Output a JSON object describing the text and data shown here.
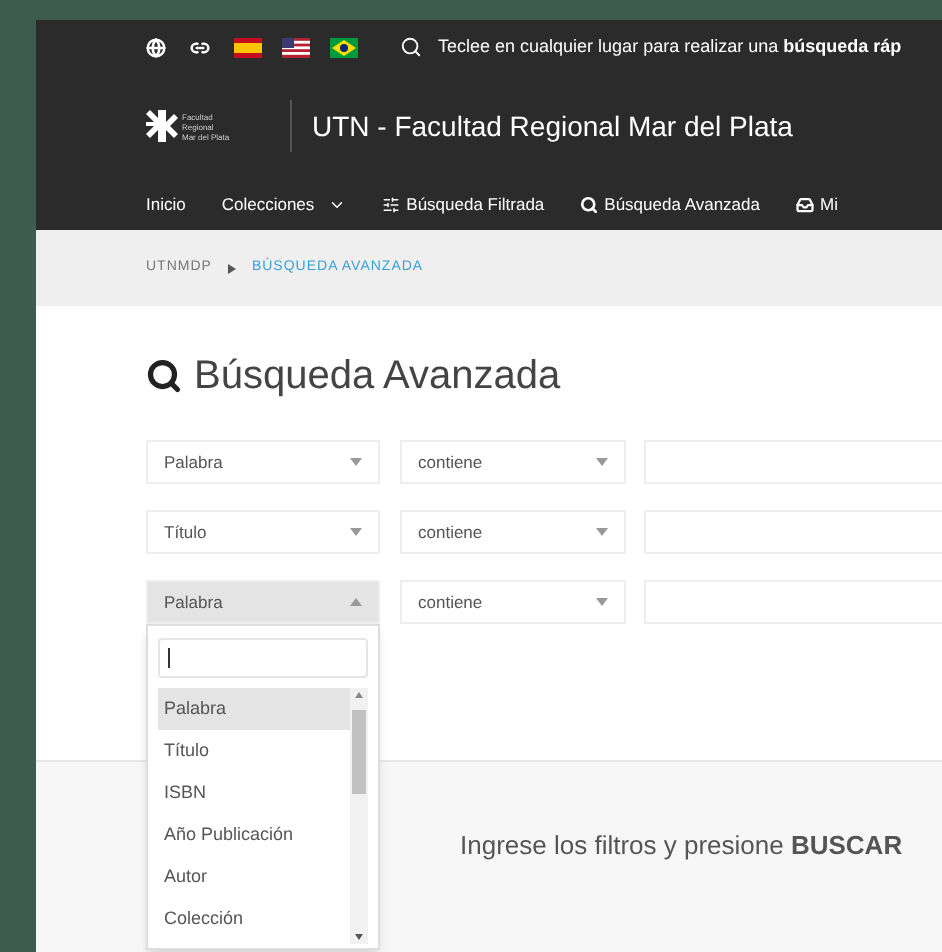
{
  "top_bar": {
    "search_hint": "Teclee en cualquier lugar para realizar una **búsqueda ráp**"
  },
  "header": {
    "logo_lines": [
      "Facultad",
      "Regional",
      "Mar del Plata"
    ],
    "title": "UTN - Facultad Regional Mar del Plata"
  },
  "nav": [
    {
      "label": "Inicio",
      "kind": "plain"
    },
    {
      "label": "Colecciones",
      "kind": "menu"
    },
    {
      "label": "Búsqueda Filtrada",
      "kind": "filter"
    },
    {
      "label": "Búsqueda Avanzada",
      "kind": "search"
    },
    {
      "label": "Mi",
      "kind": "inbox"
    }
  ],
  "breadcrumb": [
    {
      "label": "UTNMDP",
      "selected": false
    },
    {
      "label": "BÚSQUEDA AVANZADA",
      "selected": true
    }
  ],
  "heading": "Búsqueda Avanzada",
  "filters": [
    {
      "field": "Palabra",
      "expanded": false,
      "operator": "contiene"
    },
    {
      "field": "Título",
      "expanded": false,
      "operator": "contiene"
    },
    {
      "field": "Palabra",
      "expanded": true,
      "operator": "contiene"
    }
  ],
  "dropdown": {
    "options": [
      {
        "label": "Palabra",
        "selected": true
      },
      {
        "label": "Título",
        "selected": false
      },
      {
        "label": "ISBN",
        "selected": false
      },
      {
        "label": "Año Publicación",
        "selected": false
      },
      {
        "label": "Autor",
        "selected": false
      },
      {
        "label": "Colección",
        "selected": false
      }
    ]
  },
  "empty_message": "Ingrese los filtros y presione **BUSCAR**"
}
